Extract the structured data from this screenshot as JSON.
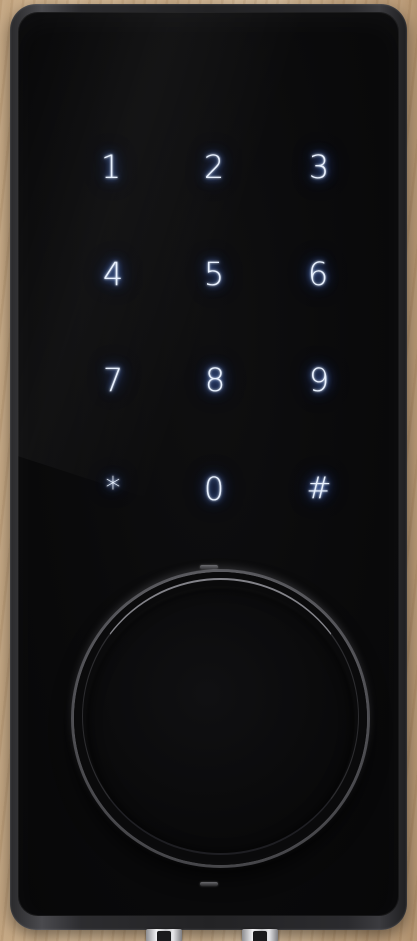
{
  "keypad": {
    "keys": [
      "1",
      "2",
      "3",
      "4",
      "5",
      "6",
      "7",
      "8",
      "9",
      "*",
      "0",
      "#"
    ],
    "glow_color": "#5a8cff"
  },
  "icons": {
    "status_led_top": "status-led-icon",
    "status_led_bottom": "status-led-icon",
    "knob": "thumb-turn-knob"
  },
  "colors": {
    "panel": "#0a0a0b",
    "body_frame": "#2a2a2c",
    "wood_background": "#d2b590"
  }
}
